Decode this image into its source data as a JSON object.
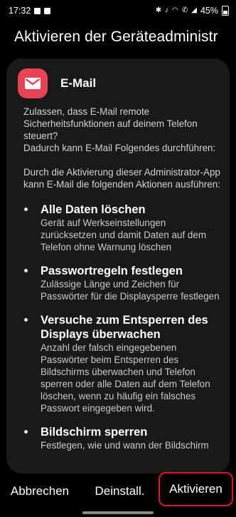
{
  "status_bar": {
    "time": "17:32",
    "battery_percent": "45%",
    "icons": [
      "image-icon",
      "notification-icon",
      "bluetooth-icon",
      "mute-icon",
      "wifi-icon",
      "call-icon",
      "signal-icon",
      "battery-icon"
    ]
  },
  "page": {
    "title": "Aktivieren der Geräteadministr"
  },
  "app": {
    "name": "E-Mail",
    "icon": "email-icon",
    "icon_color": "#e64455"
  },
  "content": {
    "intro": "Zulassen, dass E-Mail remote Sicherheitsfunktionen auf deinem Telefon steuert?",
    "intro2": "Dadurch kann E-Mail Folgendes durchführen:",
    "activation_note": "Durch die Aktivierung dieser Administrator-App kann E-Mail die folgenden Aktionen ausführen:",
    "permissions": [
      {
        "title": "Alle Daten löschen",
        "description": "Gerät auf Werkseinstellungen zurücksetzen und damit Daten auf dem Telefon ohne Warnung löschen"
      },
      {
        "title": "Passwortregeln festlegen",
        "description": "Zulässige Länge und Zeichen für Passwörter für die Displaysperre festlegen"
      },
      {
        "title": "Versuche zum Entsperren des Displays überwachen",
        "description": "Anzahl der falsch eingegebenen Passwörter beim Entsperren des Bildschirms überwachen und Telefon sperren oder alle Daten auf dem Telefon löschen, wenn zu häufig ein falsches Passwort eingegeben wird."
      },
      {
        "title": "Bildschirm sperren",
        "description": "Festlegen, wie und wann der Bildschirm"
      }
    ]
  },
  "buttons": {
    "cancel": "Abbrechen",
    "uninstall": "Deinstall.",
    "activate": "Aktivieren"
  },
  "colors": {
    "background": "#000000",
    "card": "#191919",
    "highlight": "#e0162a"
  }
}
